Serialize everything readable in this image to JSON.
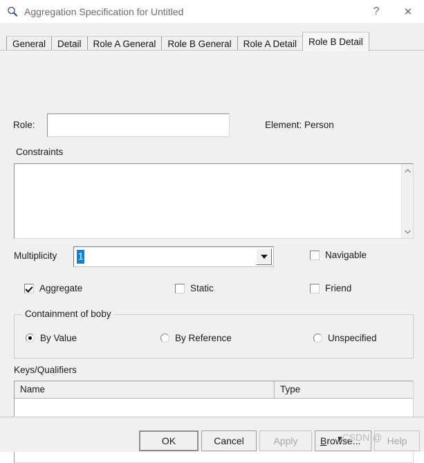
{
  "window": {
    "title": "Aggregation Specification for Untitled",
    "icon": "magnifier-icon",
    "help_button": "?",
    "close_button": "✕",
    "bg_color": "#f0f0f0"
  },
  "tabs": [
    {
      "label": "General",
      "active": false
    },
    {
      "label": "Detail",
      "active": false
    },
    {
      "label": "Role A General",
      "active": false
    },
    {
      "label": "Role B General",
      "active": false
    },
    {
      "label": "Role A Detail",
      "active": false
    },
    {
      "label": "Role B Detail",
      "active": true
    }
  ],
  "form": {
    "role_label": "Role:",
    "role_value": "",
    "role_placeholder": "",
    "element_label": "Element:",
    "element_value": "Person",
    "constraints_label": "Constraints",
    "constraints_value": "",
    "scroll_up": "⌃",
    "scroll_down": "⌄",
    "multiplicity_label": "Multiplicity",
    "multiplicity_value": "1",
    "multiplicity_selected": true,
    "checkboxes": [
      {
        "id": "navigable",
        "label": "Navigable",
        "checked": false
      },
      {
        "id": "aggregate",
        "label": "Aggregate",
        "checked": true
      },
      {
        "id": "static",
        "label": "Static",
        "checked": false
      },
      {
        "id": "friend",
        "label": "Friend",
        "checked": false
      }
    ],
    "containment": {
      "legend": "Containment of boby",
      "options": [
        {
          "id": "byvalue",
          "label": "By Value",
          "selected": true
        },
        {
          "id": "byreference",
          "label": "By Reference",
          "selected": false
        },
        {
          "id": "unspecified",
          "label": "Unspecified",
          "selected": false
        }
      ]
    },
    "keys": {
      "label": "Keys/Qualifiers",
      "columns": [
        "Name",
        "Type"
      ],
      "rows": []
    }
  },
  "buttons": {
    "ok": "OK",
    "cancel": "Cancel",
    "apply": "Apply",
    "browse_accel": "B",
    "browse_rest": "rowse...",
    "help": "Help"
  },
  "watermark": {
    "text": "CSDN @",
    "heart": "♥"
  },
  "colors": {
    "selection_blue": "#0a84d8",
    "dialog_bg": "#f0f0f0",
    "field_bg": "#ffffff"
  }
}
